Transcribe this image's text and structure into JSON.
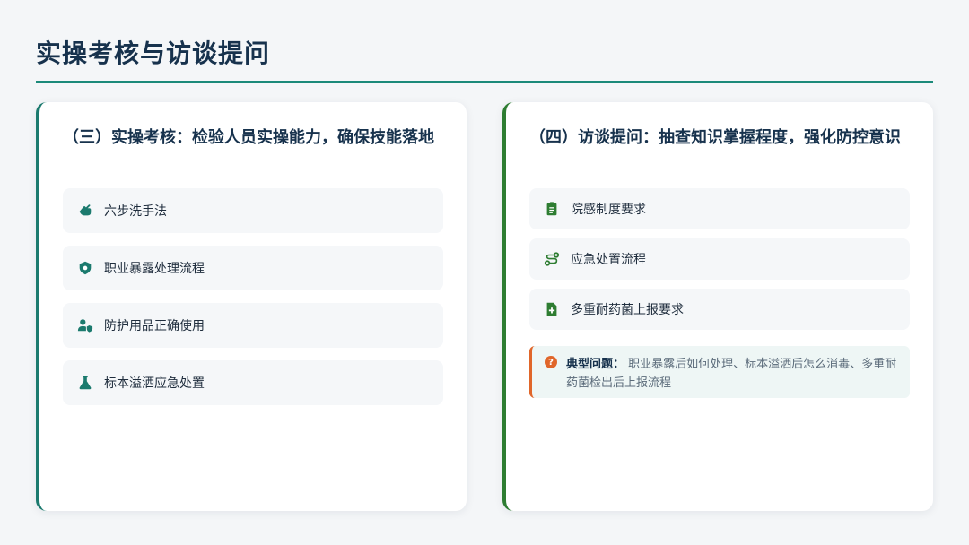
{
  "page": {
    "title": "实操考核与访谈提问"
  },
  "left_card": {
    "title": "（三）实操考核：检验人员实操能力，确保技能落地",
    "items": [
      {
        "icon": "hands-wash-icon",
        "label": "六步洗手法"
      },
      {
        "icon": "shield-virus-icon",
        "label": "职业暴露处理流程"
      },
      {
        "icon": "user-shield-icon",
        "label": "防护用品正确使用"
      },
      {
        "icon": "flask-icon",
        "label": "标本溢洒应急处置"
      }
    ]
  },
  "right_card": {
    "title": "（四）访谈提问：抽查知识掌握程度，强化防控意识",
    "items": [
      {
        "icon": "clipboard-list-icon",
        "label": "院感制度要求"
      },
      {
        "icon": "route-icon",
        "label": "应急处置流程"
      },
      {
        "icon": "file-medical-icon",
        "label": "多重耐药菌上报要求"
      }
    ],
    "note": {
      "icon": "question-circle-icon",
      "label": "典型问题：",
      "text": "职业暴露后如何处理、标本溢洒后怎么消毒、多重耐药菌检出后上报流程"
    }
  },
  "colors": {
    "accent_teal": "#1b8a7a",
    "accent_green": "#2e7d32",
    "note_orange": "#e0662a"
  }
}
